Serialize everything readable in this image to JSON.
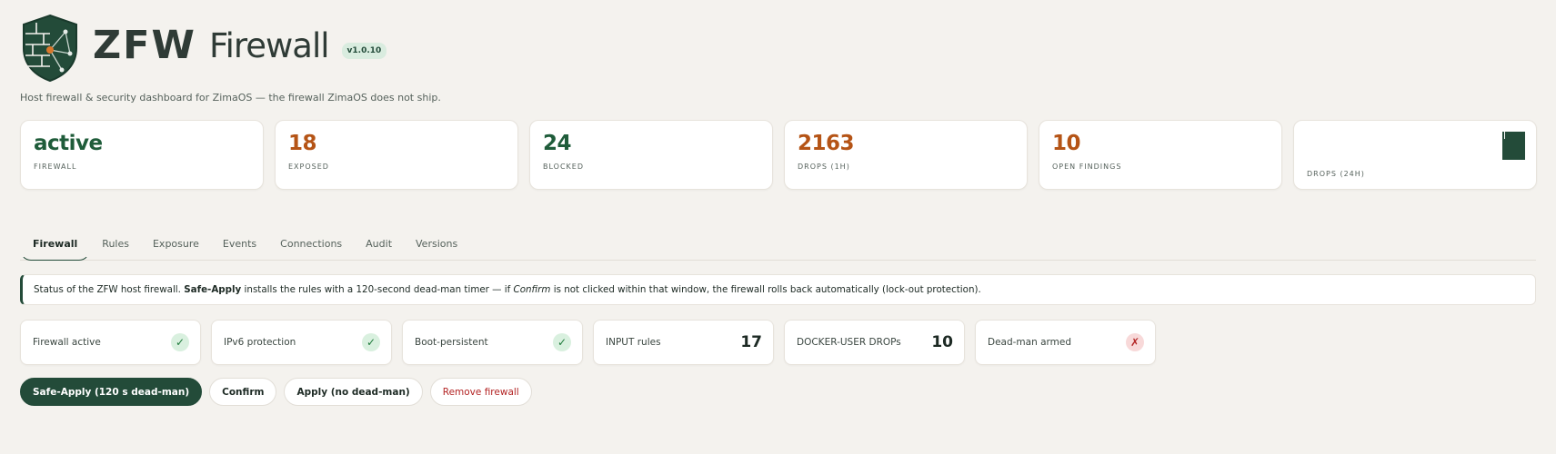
{
  "app": {
    "brand": "ZFW",
    "product": "Firewall",
    "version": "v1.0.10",
    "subtitle": "Host firewall & security dashboard for ZimaOS — the firewall ZimaOS does not ship."
  },
  "stats": [
    {
      "value": "active",
      "label": "FIREWALL"
    },
    {
      "value": "18",
      "label": "EXPOSED"
    },
    {
      "value": "24",
      "label": "BLOCKED"
    },
    {
      "value": "2163",
      "label": "DROPS (1H)"
    },
    {
      "value": "10",
      "label": "OPEN FINDINGS"
    },
    {
      "value": "",
      "label": "DROPS (24H)"
    }
  ],
  "tabs": [
    {
      "label": "Firewall",
      "active": true
    },
    {
      "label": "Rules"
    },
    {
      "label": "Exposure"
    },
    {
      "label": "Events"
    },
    {
      "label": "Connections"
    },
    {
      "label": "Audit"
    },
    {
      "label": "Versions"
    }
  ],
  "info": {
    "part1": "Status of the ZFW host firewall. ",
    "bold": "Safe-Apply",
    "part2": " installs the rules with a 120-second dead-man timer — if ",
    "italic": "Confirm",
    "part3": " is not clicked within that window, the firewall rolls back automatically (lock-out protection)."
  },
  "checks": [
    {
      "label": "Firewall active",
      "status": "ok",
      "icon": "check-icon",
      "symbol": "✓"
    },
    {
      "label": "IPv6 protection",
      "status": "ok",
      "icon": "check-icon",
      "symbol": "✓"
    },
    {
      "label": "Boot-persistent",
      "status": "ok",
      "icon": "check-icon",
      "symbol": "✓"
    },
    {
      "label": "INPUT rules",
      "value": "17"
    },
    {
      "label": "DOCKER-USER DROPs",
      "value": "10"
    },
    {
      "label": "Dead-man armed",
      "status": "bad",
      "icon": "cross-icon",
      "symbol": "✗"
    }
  ],
  "actions": {
    "safe_apply": "Safe-Apply (120 s dead-man)",
    "confirm": "Confirm",
    "apply_no_deadman": "Apply (no dead-man)",
    "remove": "Remove firewall"
  },
  "colors": {
    "accent": "#234b39",
    "ok": "#1f7a3c",
    "warning": "#b55416",
    "danger": "#b32424"
  }
}
